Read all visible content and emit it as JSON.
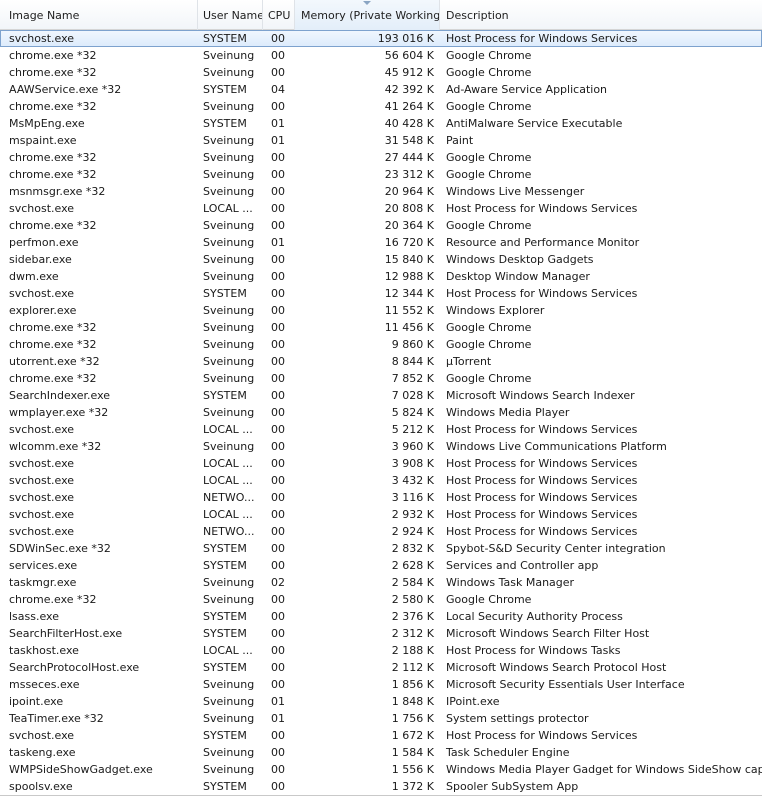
{
  "columns": {
    "name": "Image Name",
    "user": "User Name",
    "cpu": "CPU",
    "memory": "Memory (Private Working...",
    "description": "Description"
  },
  "sort": {
    "column": "memory",
    "direction": "descending"
  },
  "colors": {
    "selection": "#dcebfc",
    "selection_border": "#7da2ce",
    "header": "#f2f5f9"
  },
  "processes": [
    {
      "name": "svchost.exe",
      "user": "SYSTEM",
      "cpu": "00",
      "memory": "193 016 K",
      "description": "Host Process for Windows Services",
      "selected": true
    },
    {
      "name": "chrome.exe *32",
      "user": "Sveinung",
      "cpu": "00",
      "memory": "56 604 K",
      "description": "Google Chrome"
    },
    {
      "name": "chrome.exe *32",
      "user": "Sveinung",
      "cpu": "00",
      "memory": "45 912 K",
      "description": "Google Chrome"
    },
    {
      "name": "AAWService.exe *32",
      "user": "SYSTEM",
      "cpu": "04",
      "memory": "42 392 K",
      "description": "Ad-Aware Service Application"
    },
    {
      "name": "chrome.exe *32",
      "user": "Sveinung",
      "cpu": "00",
      "memory": "41 264 K",
      "description": "Google Chrome"
    },
    {
      "name": "MsMpEng.exe",
      "user": "SYSTEM",
      "cpu": "01",
      "memory": "40 428 K",
      "description": "AntiMalware Service Executable"
    },
    {
      "name": "mspaint.exe",
      "user": "Sveinung",
      "cpu": "01",
      "memory": "31 548 K",
      "description": "Paint"
    },
    {
      "name": "chrome.exe *32",
      "user": "Sveinung",
      "cpu": "00",
      "memory": "27 444 K",
      "description": "Google Chrome"
    },
    {
      "name": "chrome.exe *32",
      "user": "Sveinung",
      "cpu": "00",
      "memory": "23 312 K",
      "description": "Google Chrome"
    },
    {
      "name": "msnmsgr.exe *32",
      "user": "Sveinung",
      "cpu": "00",
      "memory": "20 964 K",
      "description": "Windows Live Messenger"
    },
    {
      "name": "svchost.exe",
      "user": "LOCAL ...",
      "cpu": "00",
      "memory": "20 808 K",
      "description": "Host Process for Windows Services"
    },
    {
      "name": "chrome.exe *32",
      "user": "Sveinung",
      "cpu": "00",
      "memory": "20 364 K",
      "description": "Google Chrome"
    },
    {
      "name": "perfmon.exe",
      "user": "Sveinung",
      "cpu": "01",
      "memory": "16 720 K",
      "description": "Resource and Performance Monitor"
    },
    {
      "name": "sidebar.exe",
      "user": "Sveinung",
      "cpu": "00",
      "memory": "15 840 K",
      "description": "Windows Desktop Gadgets"
    },
    {
      "name": "dwm.exe",
      "user": "Sveinung",
      "cpu": "00",
      "memory": "12 988 K",
      "description": "Desktop Window Manager"
    },
    {
      "name": "svchost.exe",
      "user": "SYSTEM",
      "cpu": "00",
      "memory": "12 344 K",
      "description": "Host Process for Windows Services"
    },
    {
      "name": "explorer.exe",
      "user": "Sveinung",
      "cpu": "00",
      "memory": "11 552 K",
      "description": "Windows Explorer"
    },
    {
      "name": "chrome.exe *32",
      "user": "Sveinung",
      "cpu": "00",
      "memory": "11 456 K",
      "description": "Google Chrome"
    },
    {
      "name": "chrome.exe *32",
      "user": "Sveinung",
      "cpu": "00",
      "memory": "9 860 K",
      "description": "Google Chrome"
    },
    {
      "name": "utorrent.exe *32",
      "user": "Sveinung",
      "cpu": "00",
      "memory": "8 844 K",
      "description": "µTorrent"
    },
    {
      "name": "chrome.exe *32",
      "user": "Sveinung",
      "cpu": "00",
      "memory": "7 852 K",
      "description": "Google Chrome"
    },
    {
      "name": "SearchIndexer.exe",
      "user": "SYSTEM",
      "cpu": "00",
      "memory": "7 028 K",
      "description": "Microsoft Windows Search Indexer"
    },
    {
      "name": "wmplayer.exe *32",
      "user": "Sveinung",
      "cpu": "00",
      "memory": "5 824 K",
      "description": "Windows Media Player"
    },
    {
      "name": "svchost.exe",
      "user": "LOCAL ...",
      "cpu": "00",
      "memory": "5 212 K",
      "description": "Host Process for Windows Services"
    },
    {
      "name": "wlcomm.exe *32",
      "user": "Sveinung",
      "cpu": "00",
      "memory": "3 960 K",
      "description": "Windows Live Communications Platform"
    },
    {
      "name": "svchost.exe",
      "user": "LOCAL ...",
      "cpu": "00",
      "memory": "3 908 K",
      "description": "Host Process for Windows Services"
    },
    {
      "name": "svchost.exe",
      "user": "LOCAL ...",
      "cpu": "00",
      "memory": "3 432 K",
      "description": "Host Process for Windows Services"
    },
    {
      "name": "svchost.exe",
      "user": "NETWO...",
      "cpu": "00",
      "memory": "3 116 K",
      "description": "Host Process for Windows Services"
    },
    {
      "name": "svchost.exe",
      "user": "LOCAL ...",
      "cpu": "00",
      "memory": "2 932 K",
      "description": "Host Process for Windows Services"
    },
    {
      "name": "svchost.exe",
      "user": "NETWO...",
      "cpu": "00",
      "memory": "2 924 K",
      "description": "Host Process for Windows Services"
    },
    {
      "name": "SDWinSec.exe *32",
      "user": "SYSTEM",
      "cpu": "00",
      "memory": "2 832 K",
      "description": "Spybot-S&D Security Center integration"
    },
    {
      "name": "services.exe",
      "user": "SYSTEM",
      "cpu": "00",
      "memory": "2 628 K",
      "description": "Services and Controller app"
    },
    {
      "name": "taskmgr.exe",
      "user": "Sveinung",
      "cpu": "02",
      "memory": "2 584 K",
      "description": "Windows Task Manager"
    },
    {
      "name": "chrome.exe *32",
      "user": "Sveinung",
      "cpu": "00",
      "memory": "2 580 K",
      "description": "Google Chrome"
    },
    {
      "name": "lsass.exe",
      "user": "SYSTEM",
      "cpu": "00",
      "memory": "2 376 K",
      "description": "Local Security Authority Process"
    },
    {
      "name": "SearchFilterHost.exe",
      "user": "SYSTEM",
      "cpu": "00",
      "memory": "2 312 K",
      "description": "Microsoft Windows Search Filter Host"
    },
    {
      "name": "taskhost.exe",
      "user": "LOCAL ...",
      "cpu": "00",
      "memory": "2 188 K",
      "description": "Host Process for Windows Tasks"
    },
    {
      "name": "SearchProtocolHost.exe",
      "user": "SYSTEM",
      "cpu": "00",
      "memory": "2 112 K",
      "description": "Microsoft Windows Search Protocol Host"
    },
    {
      "name": "msseces.exe",
      "user": "Sveinung",
      "cpu": "00",
      "memory": "1 856 K",
      "description": "Microsoft Security Essentials User Interface"
    },
    {
      "name": "ipoint.exe",
      "user": "Sveinung",
      "cpu": "01",
      "memory": "1 848 K",
      "description": "IPoint.exe"
    },
    {
      "name": "TeaTimer.exe *32",
      "user": "Sveinung",
      "cpu": "01",
      "memory": "1 756 K",
      "description": "System settings protector"
    },
    {
      "name": "svchost.exe",
      "user": "SYSTEM",
      "cpu": "00",
      "memory": "1 672 K",
      "description": "Host Process for Windows Services"
    },
    {
      "name": "taskeng.exe",
      "user": "Sveinung",
      "cpu": "00",
      "memory": "1 584 K",
      "description": "Task Scheduler Engine"
    },
    {
      "name": "WMPSideShowGadget.exe",
      "user": "Sveinung",
      "cpu": "00",
      "memory": "1 556 K",
      "description": "Windows Media Player Gadget for Windows SideShow capable dev"
    },
    {
      "name": "spoolsv.exe",
      "user": "SYSTEM",
      "cpu": "00",
      "memory": "1 372 K",
      "description": "Spooler SubSystem App"
    }
  ]
}
